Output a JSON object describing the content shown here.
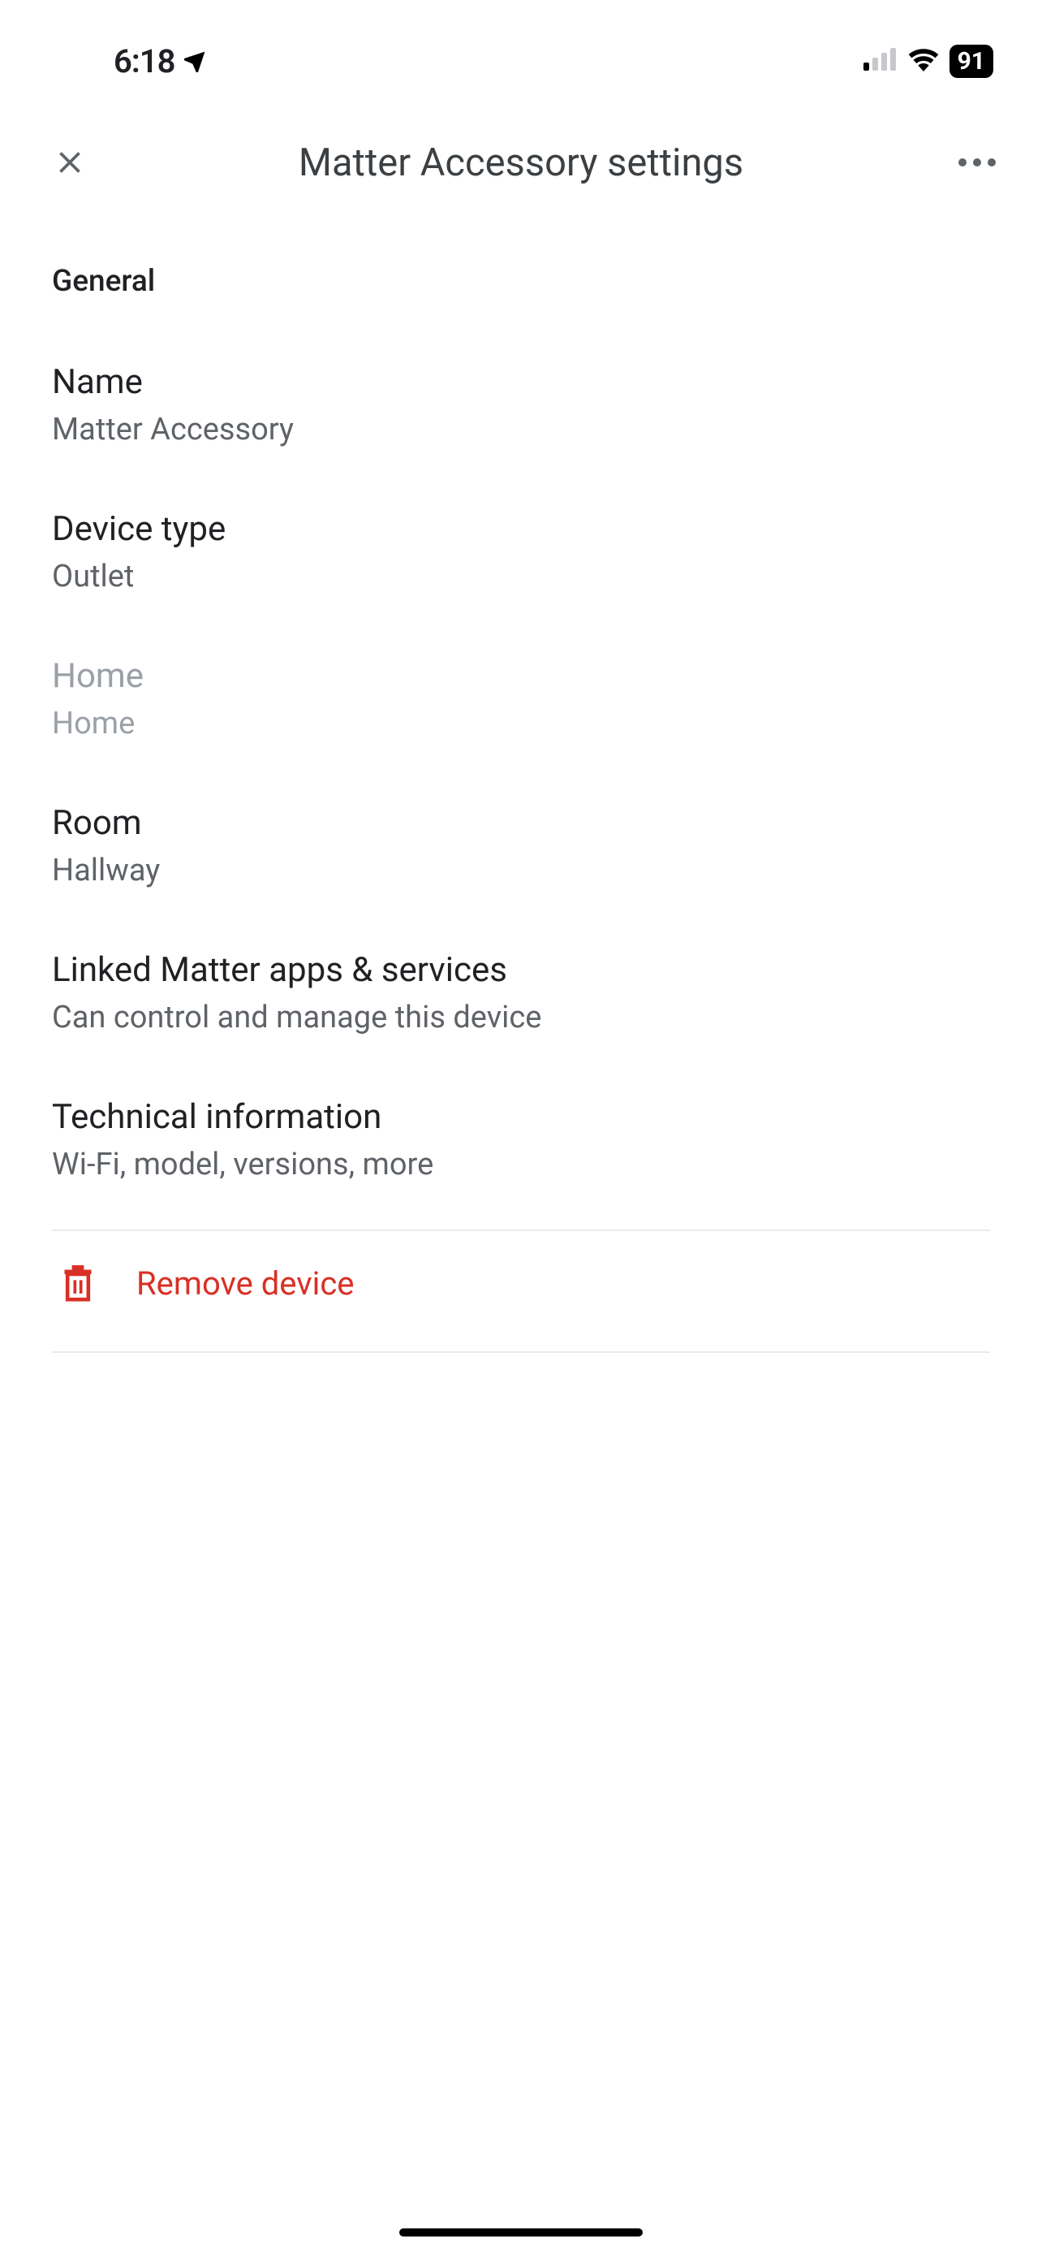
{
  "statusBar": {
    "time": "6:18",
    "battery": "91"
  },
  "header": {
    "title": "Matter Accessory settings"
  },
  "sections": {
    "generalHeader": "General"
  },
  "settings": {
    "name": {
      "title": "Name",
      "value": "Matter Accessory"
    },
    "deviceType": {
      "title": "Device type",
      "value": "Outlet"
    },
    "home": {
      "title": "Home",
      "value": "Home"
    },
    "room": {
      "title": "Room",
      "value": "Hallway"
    },
    "linkedApps": {
      "title": "Linked Matter apps & services",
      "value": "Can control and manage this device"
    },
    "technical": {
      "title": "Technical information",
      "value": "Wi-Fi, model, versions, more"
    }
  },
  "actions": {
    "removeLabel": "Remove device"
  }
}
